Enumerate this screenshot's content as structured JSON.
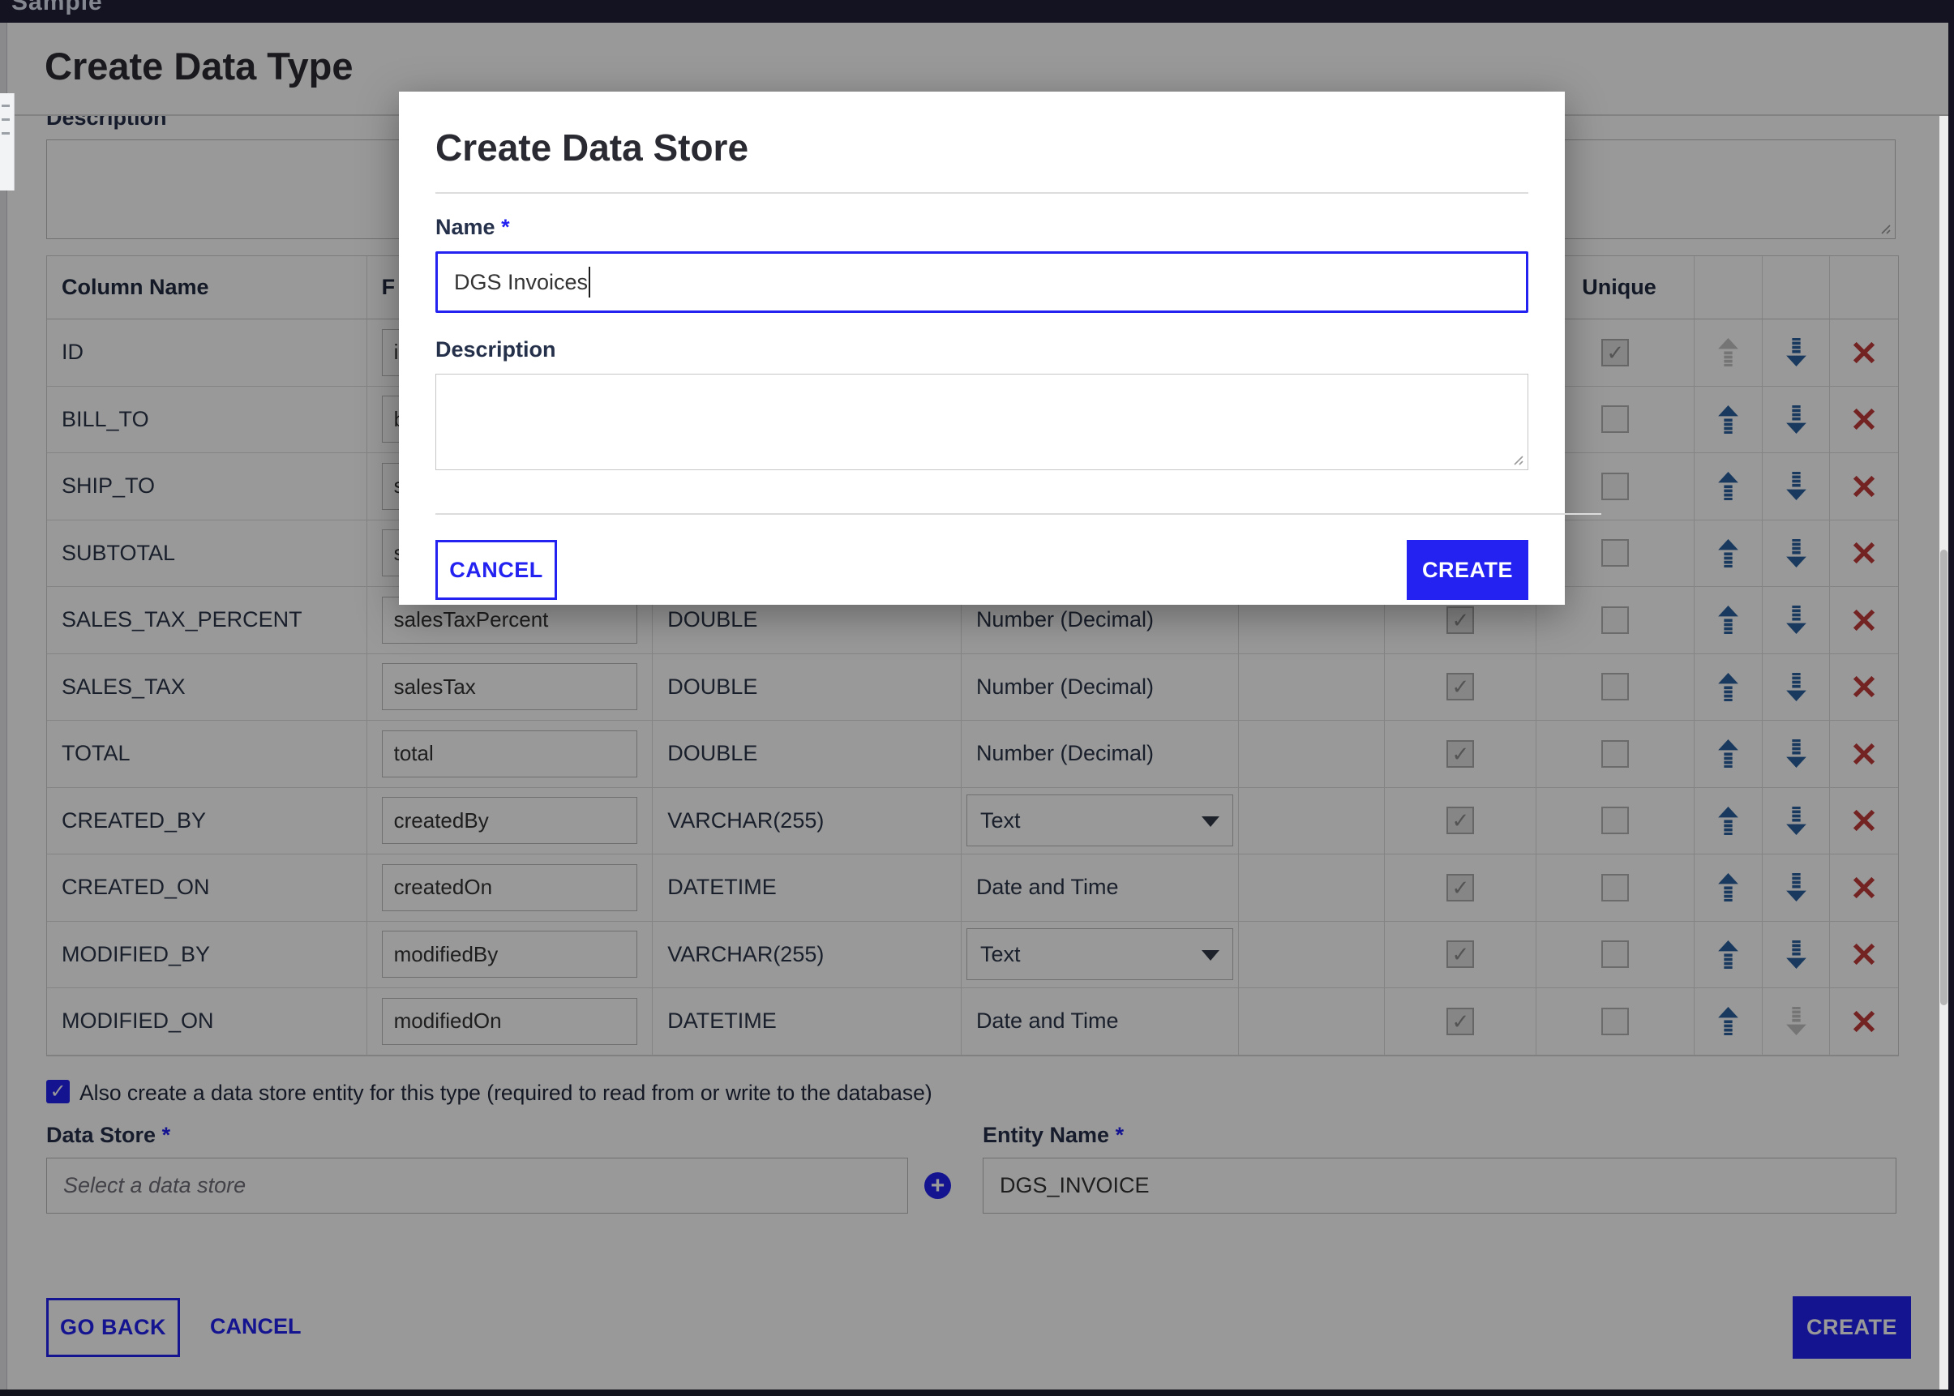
{
  "app_bar": {
    "clipped_text_fragment": "Sample"
  },
  "page": {
    "title": "Create Data Type",
    "description_label": "Description",
    "table": {
      "headers": {
        "column_name": "Column Name",
        "field_name_fragment": "F",
        "unique": "Unique"
      },
      "rows": [
        {
          "column_name": "ID",
          "field_name": "id",
          "db_type": "",
          "display_type": "",
          "display_control": "none",
          "required_checked": true,
          "unique_checked": true,
          "up_disabled": true,
          "down_disabled": false
        },
        {
          "column_name": "BILL_TO",
          "field_name": "b",
          "db_type": "",
          "display_type": "",
          "display_control": "none",
          "required_checked": true,
          "unique_checked": false,
          "up_disabled": false,
          "down_disabled": false
        },
        {
          "column_name": "SHIP_TO",
          "field_name": "s",
          "db_type": "",
          "display_type": "",
          "display_control": "none",
          "required_checked": true,
          "unique_checked": false,
          "up_disabled": false,
          "down_disabled": false
        },
        {
          "column_name": "SUBTOTAL",
          "field_name": "s",
          "db_type": "",
          "display_type": "",
          "display_control": "none",
          "required_checked": true,
          "unique_checked": false,
          "up_disabled": false,
          "down_disabled": false
        },
        {
          "column_name": "SALES_TAX_PERCENT",
          "field_name": "salesTaxPercent",
          "db_type": "DOUBLE",
          "display_type": "Number (Decimal)",
          "display_control": "text",
          "required_checked": true,
          "unique_checked": false,
          "up_disabled": false,
          "down_disabled": false
        },
        {
          "column_name": "SALES_TAX",
          "field_name": "salesTax",
          "db_type": "DOUBLE",
          "display_type": "Number (Decimal)",
          "display_control": "text",
          "required_checked": true,
          "unique_checked": false,
          "up_disabled": false,
          "down_disabled": false
        },
        {
          "column_name": "TOTAL",
          "field_name": "total",
          "db_type": "DOUBLE",
          "display_type": "Number (Decimal)",
          "display_control": "text",
          "required_checked": true,
          "unique_checked": false,
          "up_disabled": false,
          "down_disabled": false
        },
        {
          "column_name": "CREATED_BY",
          "field_name": "createdBy",
          "db_type": "VARCHAR(255)",
          "display_type": "Text",
          "display_control": "select",
          "required_checked": true,
          "unique_checked": false,
          "up_disabled": false,
          "down_disabled": false
        },
        {
          "column_name": "CREATED_ON",
          "field_name": "createdOn",
          "db_type": "DATETIME",
          "display_type": "Date and Time",
          "display_control": "text",
          "required_checked": true,
          "unique_checked": false,
          "up_disabled": false,
          "down_disabled": false
        },
        {
          "column_name": "MODIFIED_BY",
          "field_name": "modifiedBy",
          "db_type": "VARCHAR(255)",
          "display_type": "Text",
          "display_control": "select",
          "required_checked": true,
          "unique_checked": false,
          "up_disabled": false,
          "down_disabled": false
        },
        {
          "column_name": "MODIFIED_ON",
          "field_name": "modifiedOn",
          "db_type": "DATETIME",
          "display_type": "Date and Time",
          "display_control": "text",
          "required_checked": true,
          "unique_checked": false,
          "up_disabled": false,
          "down_disabled": true
        }
      ]
    },
    "entity_section": {
      "checkbox_checked": true,
      "checkbox_label": "Also create a data store entity for this type (required to read from or write to the database)",
      "data_store_label": "Data Store",
      "required_marker": "*",
      "data_store_placeholder": "Select a data store",
      "entity_name_label": "Entity Name",
      "entity_name_value": "DGS_INVOICE"
    },
    "footer": {
      "go_back": "GO BACK",
      "cancel": "CANCEL",
      "create": "CREATE"
    }
  },
  "modal": {
    "title": "Create Data Store",
    "name_label": "Name",
    "required_marker": "*",
    "name_value": "DGS Invoices",
    "description_label": "Description",
    "description_value": "",
    "cancel": "CANCEL",
    "create": "CREATE"
  },
  "colors": {
    "primary_blue": "#2322f0",
    "arrow_blue": "#2a609d",
    "disabled_arrow_gray": "#c3c3c3",
    "delete_red": "#c23b3b",
    "overlay": "rgba(0,0,0,0.40)"
  }
}
